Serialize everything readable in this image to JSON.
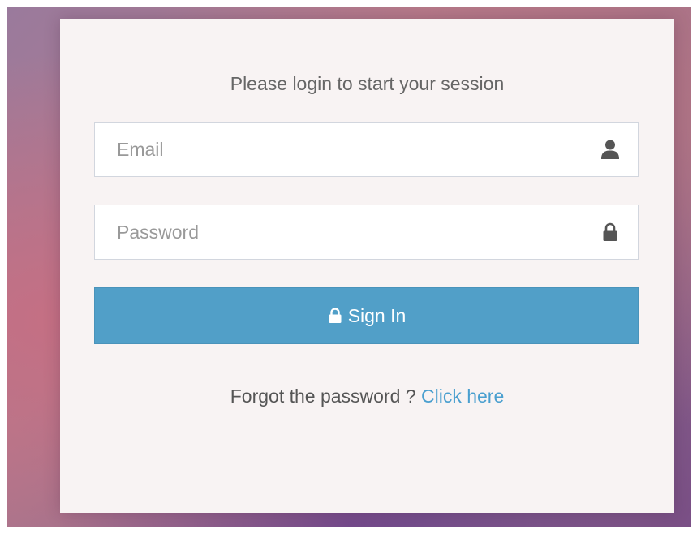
{
  "login": {
    "message": "Please login to start your session",
    "email": {
      "placeholder": "Email",
      "value": "",
      "icon": "user-icon"
    },
    "password": {
      "placeholder": "Password",
      "value": "",
      "icon": "lock-icon"
    },
    "signin": {
      "label": "Sign In",
      "icon": "lock-icon",
      "color": "#519fc8"
    },
    "forgot": {
      "text": "Forgot the password ?",
      "link_label": "Click here",
      "link_color": "#4a9fcf"
    }
  }
}
